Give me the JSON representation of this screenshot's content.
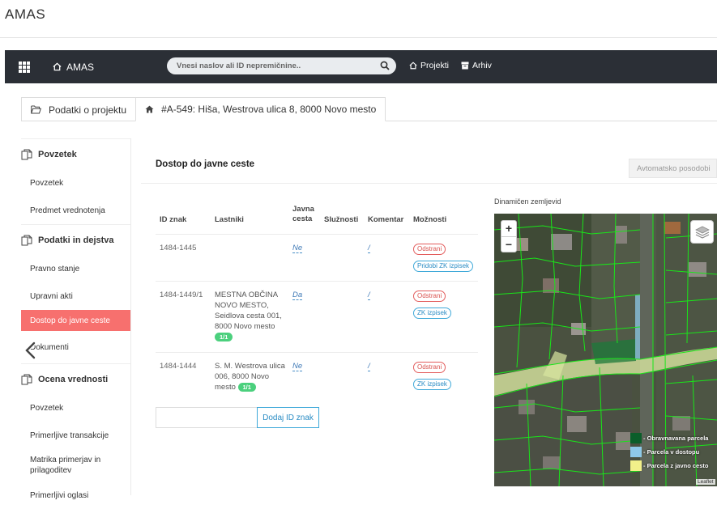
{
  "app_title": "AMAS",
  "navbar": {
    "brand": "AMAS",
    "search_placeholder": "Vnesi naslov ali ID nepremičnine..",
    "links": [
      "Projekti",
      "Arhiv"
    ]
  },
  "tabs": [
    {
      "label": "Podatki o projektu",
      "icon": "folder-open-icon"
    },
    {
      "label": "#A-549: Hiša, Westrova ulica 8, 8000 Novo mesto",
      "icon": "home-icon"
    }
  ],
  "sidebar": {
    "sections": [
      {
        "title": "Povzetek",
        "items": [
          "Povzetek",
          "Predmet vrednotenja"
        ]
      },
      {
        "title": "Podatki in dejstva",
        "items": [
          "Pravno stanje",
          "Upravni akti",
          "Dostop do javne ceste",
          "Dokumenti"
        ]
      },
      {
        "title": "Ocena vrednosti",
        "items": [
          "Povzetek",
          "Primerljive transakcije",
          "Matrika primerjav in prilagoditev",
          "Primerljivi oglasi"
        ]
      }
    ],
    "active_item": "Dostop do javne ceste"
  },
  "main": {
    "title": "Dostop do javne ceste",
    "auto_update_button": "Avtomatsko posodobi",
    "table": {
      "headers": [
        "ID znak",
        "Lastniki",
        "Javna cesta",
        "Služnosti",
        "Komentar",
        "Možnosti"
      ],
      "rows": [
        {
          "id": "1484-1445",
          "owners": "",
          "owners_count": "",
          "public_road": "Ne",
          "comment": "/",
          "actions": [
            "Odstrani",
            "Pridobi ZK izpisek"
          ]
        },
        {
          "id": "1484-1449/1",
          "owners": "MESTNA OBČINA NOVO MESTO, Seidlova cesta 001, 8000 Novo mesto",
          "owners_count": "1/1",
          "public_road": "Da",
          "comment": "/",
          "actions": [
            "Odstrani",
            "ZK izpisek"
          ]
        },
        {
          "id": "1484-1444",
          "owners": "S. M. Westrova ulica 006, 8000 Novo mesto",
          "owners_count": "1/1",
          "public_road": "Ne",
          "comment": "/",
          "actions": [
            "Odstrani",
            "ZK izpisek"
          ]
        }
      ]
    },
    "add_input_value": "",
    "add_button": "Dodaj ID znak"
  },
  "map": {
    "label": "Dinamičen zemljevid",
    "zoom_in": "+",
    "zoom_out": "−",
    "legend": [
      {
        "label": "- Obravnavana parcela",
        "color": "#0b5e2a"
      },
      {
        "label": "- Parcela v dostopu",
        "color": "#8ec9e8"
      },
      {
        "label": "- Parcela z javno cesto",
        "color": "#f2f08a"
      }
    ],
    "attribution": "Leaflet"
  },
  "colors": {
    "navbar": "#2b2f36",
    "active_sidebar": "#f7706e",
    "parcel_lines": "#19e619"
  }
}
